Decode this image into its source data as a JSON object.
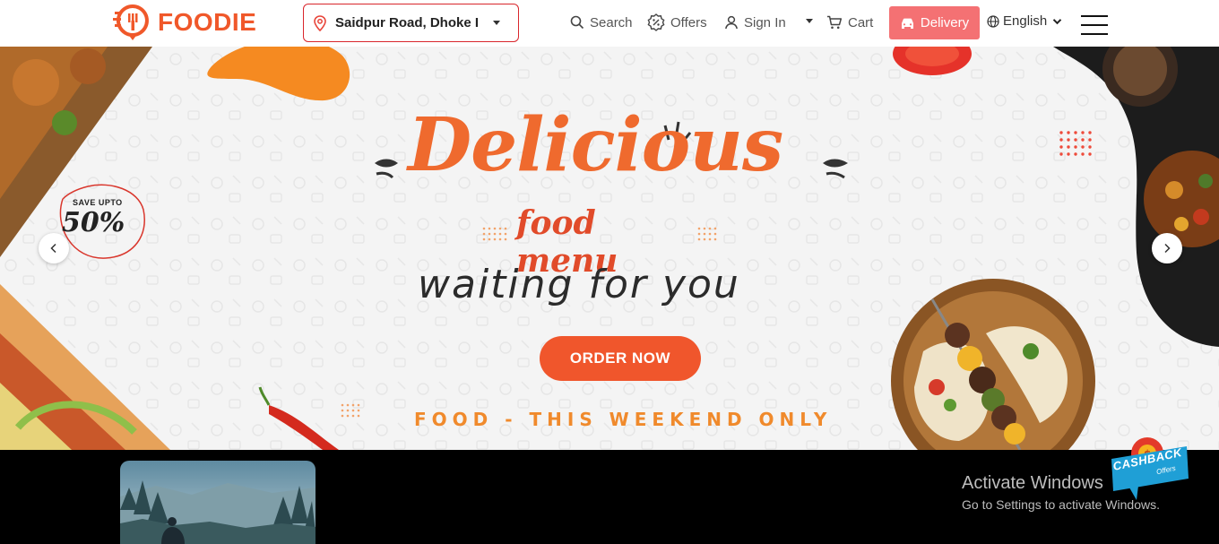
{
  "brand": {
    "name": "FOODIE",
    "color": "#f0582a"
  },
  "location": {
    "value": "Saidpur Road, Dhoke I"
  },
  "nav": {
    "search": "Search",
    "offers": "Offers",
    "signin": "Sign In",
    "cart": "Cart",
    "delivery": "Delivery",
    "language": "English"
  },
  "hero": {
    "badge_small": "SAVE UPTO",
    "badge_big": "50%",
    "headline": "Delicious",
    "subheadline": "food menu",
    "tagline": "waiting for you",
    "cta": "ORDER NOW",
    "promo": "FOOD - THIS WEEKEND ONLY"
  },
  "windows_notice": {
    "title": "Activate Windows",
    "subtitle": "Go to Settings to activate Windows."
  },
  "cashback": {
    "label": "CASHBACK",
    "sub": "Offers"
  },
  "colors": {
    "accent": "#f0582a",
    "delivery": "#f47173",
    "location_border": "#d9262c"
  }
}
